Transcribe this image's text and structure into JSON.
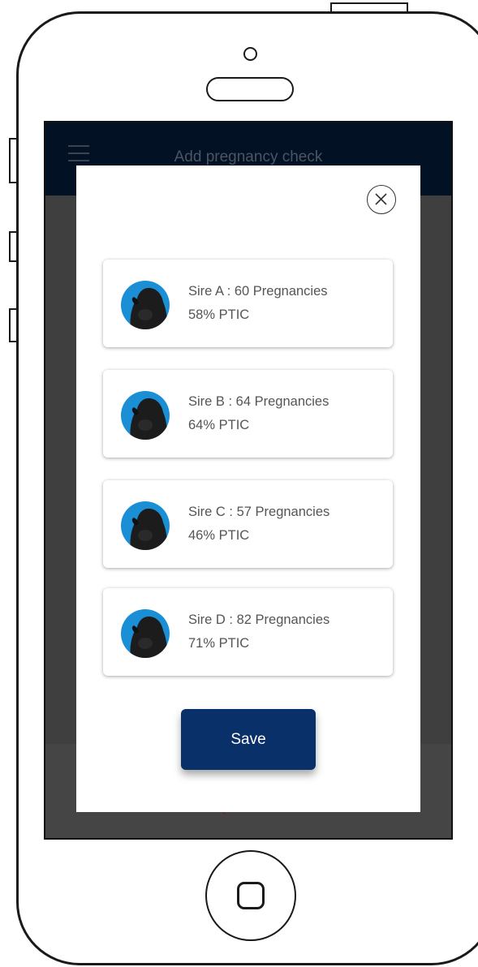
{
  "app_bar": {
    "title": "Add pregnancy check"
  },
  "modal": {
    "close_icon": "close-circle-icon",
    "sires": [
      {
        "title": "Sire A : 60 Pregnancies",
        "ptic": "58% PTIC",
        "avatar_icon": "bull-photo"
      },
      {
        "title": "Sire B : 64 Pregnancies",
        "ptic": "64% PTIC",
        "avatar_icon": "bull-photo"
      },
      {
        "title": "Sire C : 57 Pregnancies",
        "ptic": "46% PTIC",
        "avatar_icon": "bull-photo"
      },
      {
        "title": "Sire D : 82 Pregnancies",
        "ptic": "71% PTIC",
        "avatar_icon": "bull-photo"
      }
    ],
    "save_label": "Save"
  },
  "colors": {
    "app_bar": "#021124",
    "save_button": "#0a3069",
    "avatar_bg": "#1b8fd6",
    "overlay": "#3f3f3f"
  }
}
